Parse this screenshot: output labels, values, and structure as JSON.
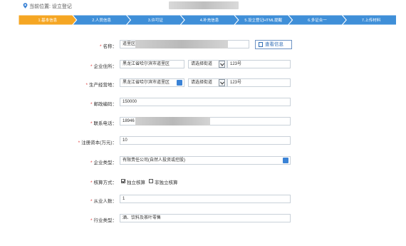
{
  "header": {
    "location_label": "当前位置: 设立登记"
  },
  "steps": [
    {
      "label": "1.基本信息",
      "active": true
    },
    {
      "label": "2.人员信息",
      "active": false
    },
    {
      "label": "3.许可证",
      "active": false
    },
    {
      "label": "4.补充信息",
      "active": false
    },
    {
      "label": "5.设立登记HTML提醒",
      "active": false
    },
    {
      "label": "6.多证合一",
      "active": false
    },
    {
      "label": "7.上传材料",
      "active": false
    }
  ],
  "colors": {
    "active_step": "#f5a623",
    "inactive_step": "#3f8fd8",
    "required": "#e03c3c",
    "accent": "#2f6db5"
  },
  "form": {
    "name": {
      "label": "名称：",
      "value": "道里区",
      "button": "查看信息"
    },
    "address": {
      "label": "企业住所：",
      "region": "黑龙江省哈尔滨市道里区",
      "street_select": "请选择街道",
      "detail": "123号"
    },
    "business_address": {
      "label": "生产经营地：",
      "region": "黑龙江省哈尔滨市道里区",
      "street_select": "请选择街道",
      "detail": "123号"
    },
    "postcode": {
      "label": "邮政编码：",
      "value": "150000"
    },
    "phone": {
      "label": "联系电话：",
      "value": "18946"
    },
    "capital": {
      "label": "注册资本(万元)：",
      "value": "10"
    },
    "company_type": {
      "label": "企业类型：",
      "value": "有限责任公司(自然人投资或控股)"
    },
    "accounting": {
      "label": "核算方式：",
      "option1": "独立核算",
      "option1_checked": true,
      "option2": "非独立核算",
      "option2_checked": false
    },
    "employees": {
      "label": "从业人数：",
      "value": "1"
    },
    "industry": {
      "label": "行业类型：",
      "value": "酒、饮料及茶叶零售"
    }
  }
}
